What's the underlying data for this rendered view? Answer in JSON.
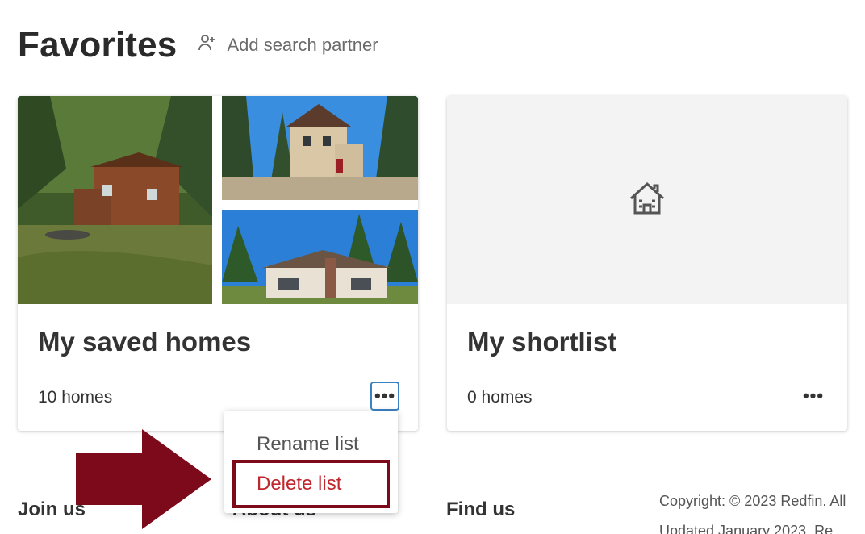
{
  "header": {
    "title": "Favorites",
    "add_partner_label": "Add search partner"
  },
  "lists": [
    {
      "title": "My saved homes",
      "count": "10 homes"
    },
    {
      "title": "My shortlist",
      "count": "0 homes"
    }
  ],
  "menu": {
    "rename_label": "Rename list",
    "delete_label": "Delete list"
  },
  "footer": {
    "join_label": "Join us",
    "about_label": "About us",
    "find_label": "Find us",
    "copyright": "Copyright: © 2023 Redfin. All",
    "updated": "Updated January 2023. Re"
  },
  "colors": {
    "focus_ring": "#3b82c4",
    "delete_text": "#c0262d",
    "annotation": "#7c0a1a"
  },
  "icons": [
    "add-person-icon",
    "house-icon",
    "more-icon",
    "arrow-icon"
  ]
}
